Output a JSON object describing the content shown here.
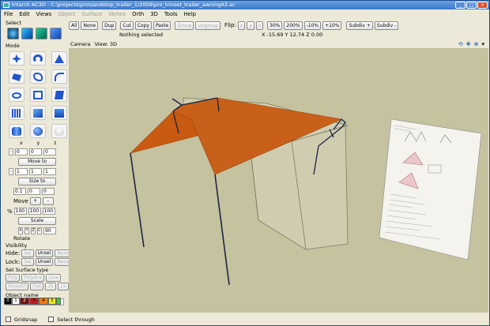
{
  "window": {
    "title": "Intarch AC3D - C:\\projects\\pro\\sandstop_trailer_1/2009\\pro_trinest_trailer_awningA3.ac"
  },
  "menu": [
    "File",
    "Edit",
    "Views",
    "Object",
    "Surface",
    "Vertex",
    "Orth",
    "3D",
    "Tools",
    "Help"
  ],
  "menu_disabled": [
    "Object",
    "Surface",
    "Vertex"
  ],
  "left": {
    "select_label": "Select",
    "mode_label": "Mode",
    "xyz": [
      "x",
      "y",
      "z"
    ],
    "pos": [
      "0",
      "0",
      "0"
    ],
    "move_to": "Move to",
    "size": [
      "1",
      "1",
      "1"
    ],
    "size_to": "Size to",
    "move_vals": [
      "0.1",
      "0",
      "0"
    ],
    "move": "Move",
    "plus": "+",
    "minus": "-",
    "scale_pct": "%",
    "scale_vals": [
      "100",
      "100",
      "100"
    ],
    "scale": "Scale",
    "axes": [
      "X",
      "Y",
      "Z",
      "C"
    ],
    "rot_val": "90",
    "rotate": "Rotate",
    "visibility": "Visibility",
    "hide": "Hide:",
    "lock": "Lock:",
    "sel": "Sel",
    "unsel": "Unsel",
    "none": "None",
    "set_surface": "Set Surface type",
    "poly": "Poly",
    "polyline": "Polyline",
    "line": "Line",
    "smooth": "Smooth",
    "flat": "Flat",
    "two1": "2S",
    "one1": "1S",
    "object_name": "Object name"
  },
  "palette": [
    "0",
    "1",
    "2",
    "3",
    "4",
    "5"
  ],
  "toolbar": {
    "row1": [
      "All",
      "None",
      "Dup",
      "Cut",
      "Copy",
      "Paste",
      "Group",
      "Ungroup"
    ],
    "row1_disabled": [
      "Group",
      "Ungroup"
    ],
    "flip": "Flip:",
    "flip_axes": [
      "x",
      "y",
      "z"
    ],
    "zoom": [
      "30%",
      "200%",
      "-10%",
      "+10%"
    ],
    "subdiv_plus": "Subdiv +",
    "subdiv_minus": "Subdiv -",
    "status": "Nothing selected",
    "coords": "X -15.69 Y 12.74 Z 0.00"
  },
  "camera": {
    "label": "Camera",
    "view": "View: 3D"
  },
  "bottom": {
    "gridsnap": "Gridsnap",
    "select_through": "Select through"
  },
  "colors": {
    "awning": "#c85a12",
    "frame": "#1e2640",
    "box_fill": "#d9d6bb",
    "viewport": "#c5c2a0"
  }
}
